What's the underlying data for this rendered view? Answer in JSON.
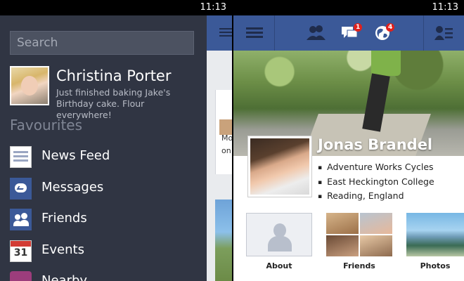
{
  "left_phone": {
    "status_time": "11:13",
    "search": {
      "placeholder": "Search"
    },
    "profile": {
      "name": "Christina Porter",
      "status": "Just finished baking Jake's Birthday cake. Flour everywhere!"
    },
    "favourites_title": "Favourites",
    "menu": [
      {
        "label": "News Feed",
        "icon": "news-feed-icon"
      },
      {
        "label": "Messages",
        "icon": "messages-icon"
      },
      {
        "label": "Friends",
        "icon": "friends-icon"
      },
      {
        "label": "Events",
        "icon": "events-icon",
        "icon_text": "31"
      },
      {
        "label": "Nearby",
        "icon": "nearby-icon"
      }
    ],
    "peek_text": [
      "Mo",
      "on"
    ]
  },
  "right_phone": {
    "status_time": "11:13",
    "topbar": {
      "friend_requests_icon": "friend-requests-icon",
      "messages_badge": "1",
      "notifications_badge": "4",
      "menu_icon": "menu-icon",
      "friends_list_icon": "friends-list-icon"
    },
    "profile": {
      "name": "Jonas Brandel",
      "facts": [
        "Adventure Works Cycles",
        "East Heckington College",
        "Reading, England"
      ]
    },
    "tiles": [
      {
        "label": "About"
      },
      {
        "label": "Friends"
      },
      {
        "label": "Photos"
      }
    ]
  },
  "colors": {
    "brand_blue": "#3b5998",
    "drawer_bg": "#303543",
    "badge_red": "#e0211c"
  }
}
